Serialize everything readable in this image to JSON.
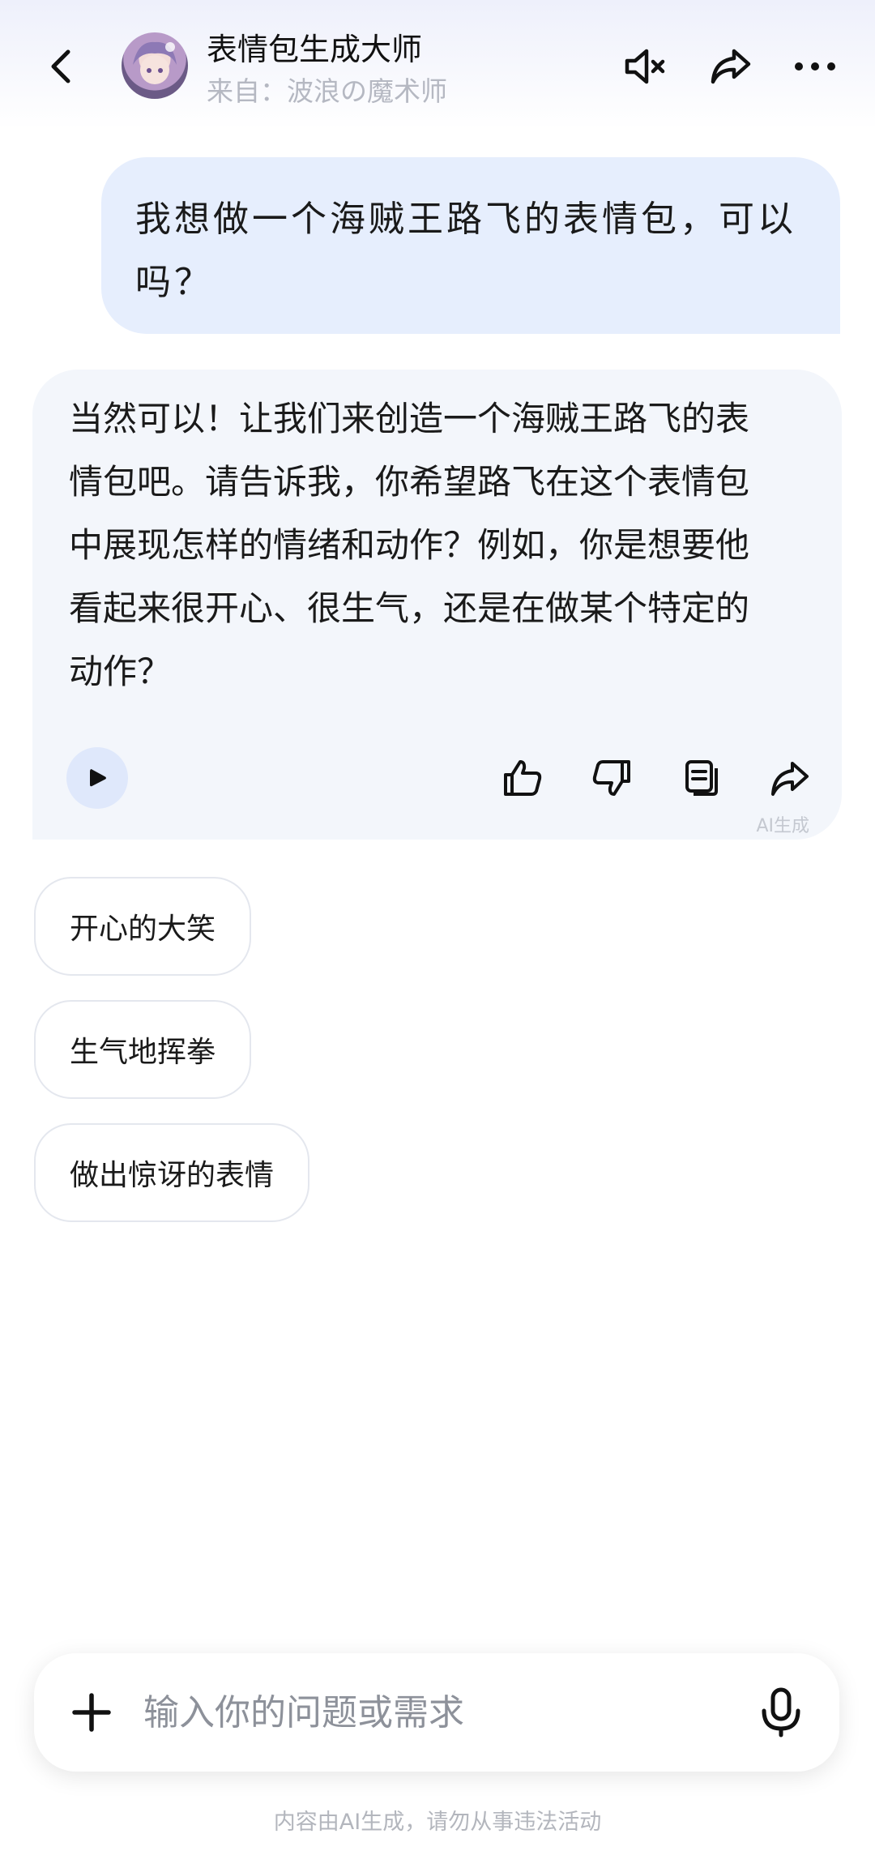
{
  "header": {
    "title": "表情包生成大师",
    "subtitle": "来自：波浪の魔术师",
    "icons": [
      "back-icon",
      "mute-icon",
      "share-icon",
      "more-icon"
    ]
  },
  "messages": [
    {
      "role": "user",
      "text": "我想做一个海贼王路飞的表情包，可以吗？"
    },
    {
      "role": "assistant",
      "lines": [
        "当然可以！让我们来创造一个海贼王路飞的表",
        "情包吧。请告诉我，你希望路飞在这个表情包",
        "中展现怎样的情绪和动作？例如，你是想要他",
        "看起来很开心、很生气，还是在做某个特定的",
        "动作？"
      ],
      "ai_label": "AI生成",
      "actions": [
        "play-icon",
        "thumbs-up-icon",
        "thumbs-down-icon",
        "copy-icon",
        "share-icon"
      ]
    }
  ],
  "suggestions": [
    "开心的大笑",
    "生气地挥拳",
    "做出惊讶的表情"
  ],
  "input": {
    "placeholder": "输入你的问题或需求",
    "value": ""
  },
  "footer": "内容由AI生成，请勿从事违法活动",
  "colors": {
    "user_bubble": "#e6eefd",
    "bot_bubble": "#f3f6fb",
    "play_bg": "#dfe8fb"
  }
}
